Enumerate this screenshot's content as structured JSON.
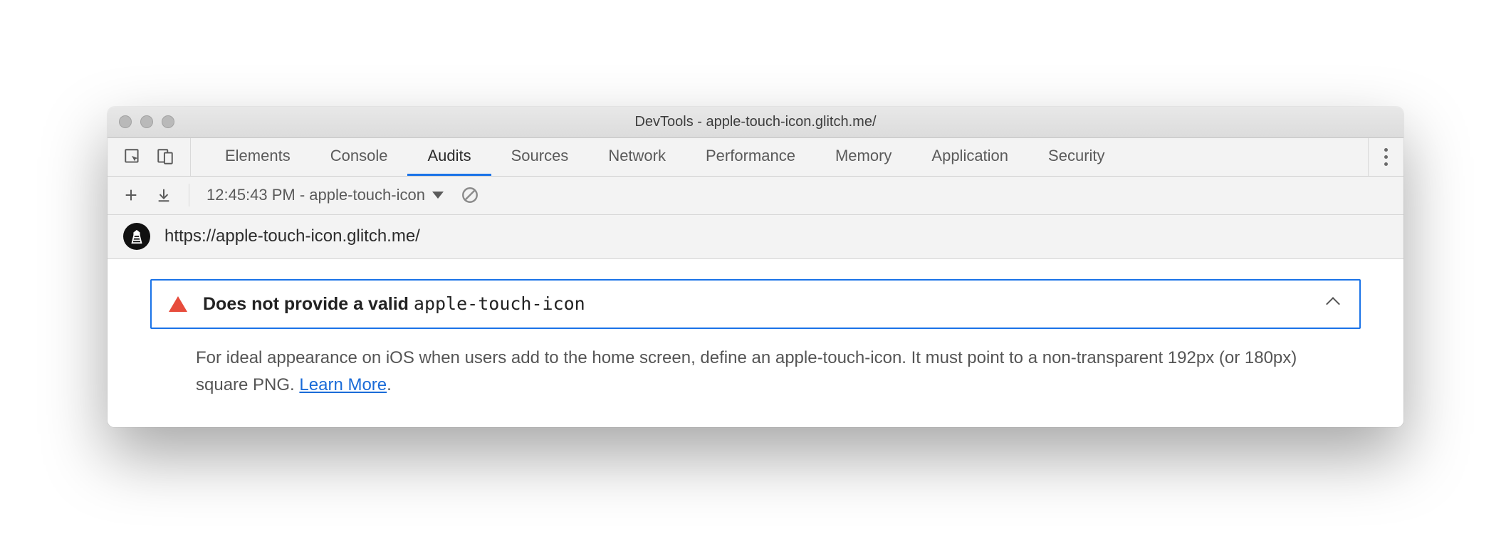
{
  "window": {
    "title": "DevTools - apple-touch-icon.glitch.me/"
  },
  "tabs": {
    "items": [
      "Elements",
      "Console",
      "Audits",
      "Sources",
      "Network",
      "Performance",
      "Memory",
      "Application",
      "Security"
    ],
    "active_index": 2
  },
  "toolbar": {
    "run_label": "12:45:43 PM - apple-touch-icon"
  },
  "url_row": {
    "url": "https://apple-touch-icon.glitch.me/"
  },
  "audit": {
    "title_prefix": "Does not provide a valid ",
    "title_code": "apple-touch-icon",
    "description": "For ideal appearance on iOS when users add to the home screen, define an apple-touch-icon. It must point to a non-transparent 192px (or 180px) square PNG. ",
    "learn_more": "Learn More",
    "period": "."
  }
}
